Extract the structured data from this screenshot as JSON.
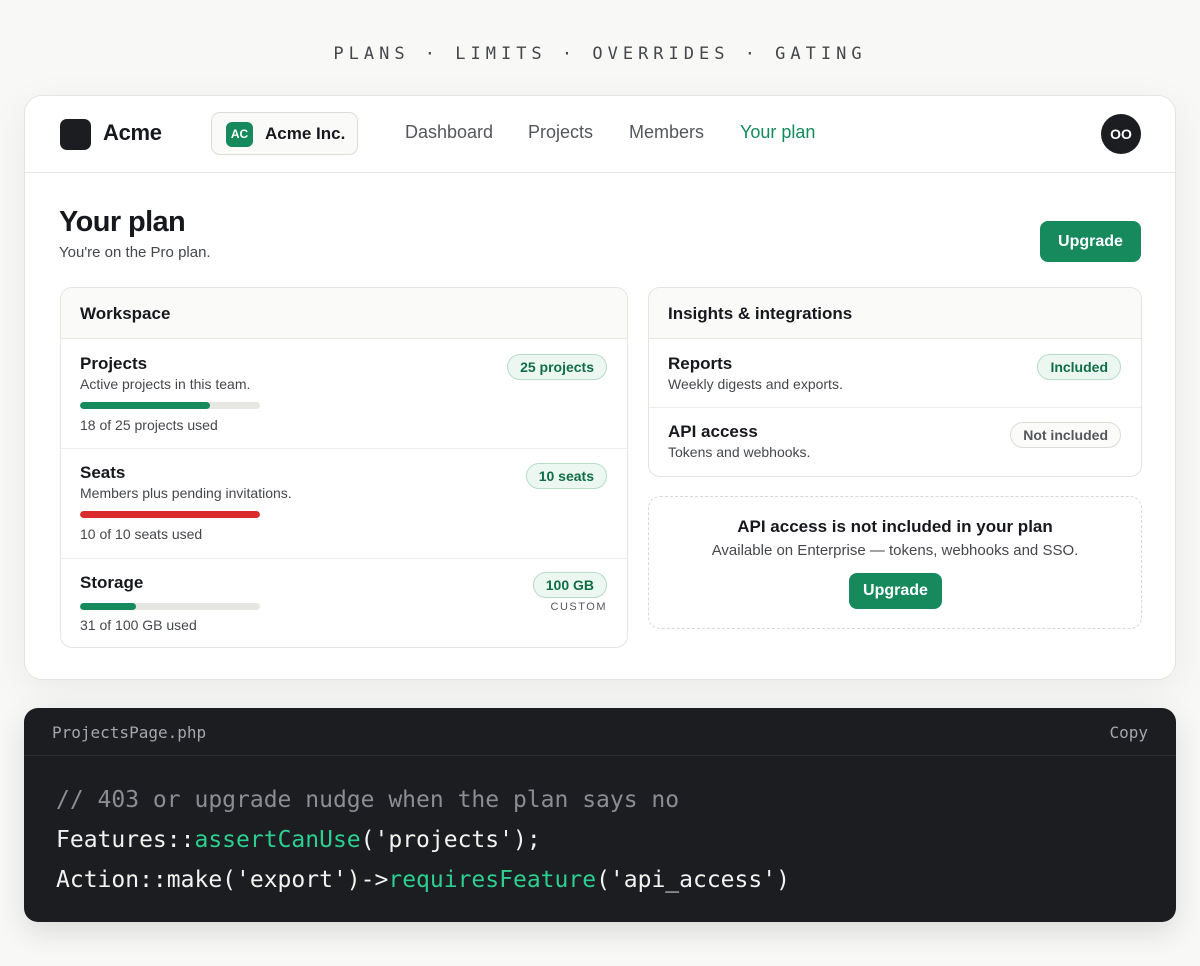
{
  "eyebrow": "PLANS · LIMITS · OVERRIDES · GATING",
  "app": {
    "brand": "Acme",
    "team": {
      "initials": "AC",
      "name": "Acme Inc."
    },
    "nav": [
      {
        "label": "Dashboard",
        "active": false
      },
      {
        "label": "Projects",
        "active": false
      },
      {
        "label": "Members",
        "active": false
      },
      {
        "label": "Your plan",
        "active": true
      }
    ],
    "user_initials": "OO",
    "page": {
      "title": "Your plan",
      "subtitle": "You're on the Pro plan.",
      "upgrade_label": "Upgrade"
    },
    "workspace": {
      "heading": "Workspace",
      "items": [
        {
          "title": "Projects",
          "description": "Active projects in this team.",
          "badge": "25 projects",
          "used": 18,
          "limit": 25,
          "usage_text": "18 of 25 projects used",
          "status": "ok"
        },
        {
          "title": "Seats",
          "description": "Members plus pending invitations.",
          "badge": "10 seats",
          "used": 10,
          "limit": 10,
          "usage_text": "10 of 10 seats used",
          "status": "full"
        },
        {
          "title": "Storage",
          "description": "",
          "badge": "100 GB",
          "tag": "CUSTOM",
          "used": 31,
          "limit": 100,
          "usage_text": "31 of 100 GB used",
          "status": "ok"
        }
      ]
    },
    "insights": {
      "heading": "Insights & integrations",
      "items": [
        {
          "title": "Reports",
          "description": "Weekly digests and exports.",
          "badge": "Included",
          "included": true
        },
        {
          "title": "API access",
          "description": "Tokens and webhooks.",
          "badge": "Not included",
          "included": false
        }
      ]
    },
    "gate": {
      "title": "API access is not included in your plan",
      "description": "Available on Enterprise — tokens, webhooks and SSO.",
      "button": "Upgrade"
    }
  },
  "code": {
    "filename": "ProjectsPage.php",
    "copy_label": "Copy",
    "comment": "// 403 or upgrade nudge when the plan says no",
    "line2": {
      "pre": "Features::",
      "fn": "assertCanUse",
      "post": "('projects');"
    },
    "line3": {
      "pre": "Action::make('export')->",
      "fn": "requiresFeature",
      "post": "('api_access')"
    }
  },
  "colors": {
    "accent": "#168a5c",
    "meter_ok": "#168a5c",
    "meter_full": "#d92d2d",
    "code_fn": "#2ccf8f"
  }
}
